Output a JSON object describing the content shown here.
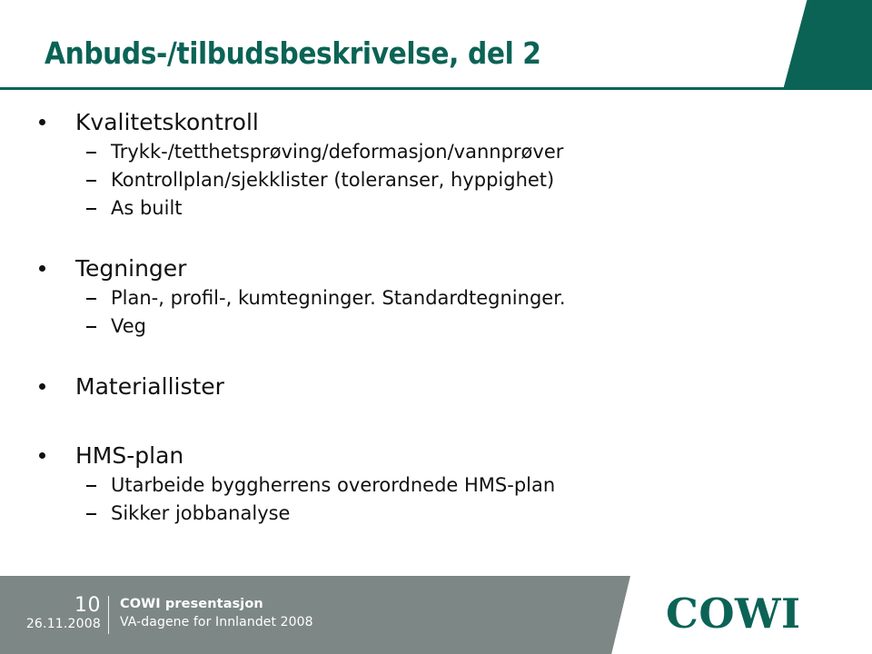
{
  "slide": {
    "title": "Anbuds-/tilbudsbeskrivelse, del 2",
    "accent_color": "#0b6356",
    "footer_bar_color": "#7d8785",
    "body_text_color": "#111111"
  },
  "content": {
    "groups": [
      {
        "heading": "Kvalitetskontroll",
        "items": [
          "Trykk-/tetthetsprøving/deformasjon/vannprøver",
          "Kontrollplan/sjekklister (toleranser, hyppighet)",
          "As built"
        ]
      },
      {
        "heading": "Tegninger",
        "items": [
          "Plan-, profil-, kumtegninger. Standardtegninger.",
          "Veg"
        ]
      },
      {
        "heading": "Materiallister",
        "items": []
      },
      {
        "heading": "HMS-plan",
        "items": [
          "Utarbeide byggherrens overordnede HMS-plan",
          "Sikker jobbanalyse"
        ]
      }
    ]
  },
  "footer": {
    "page_number": "10",
    "date": "26.11.2008",
    "presentation_title": "COWI presentasjon",
    "presentation_subtitle": "VA-dagene for Innlandet 2008",
    "logo_text": "COWI"
  }
}
